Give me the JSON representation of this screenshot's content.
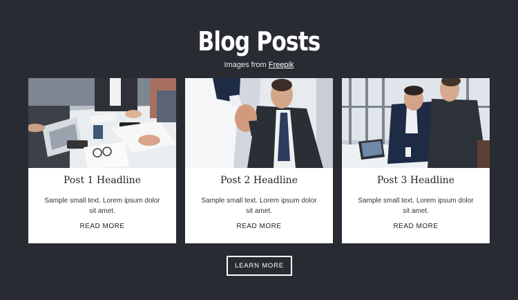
{
  "header": {
    "title": "Blog Posts",
    "credit_prefix": "Images from",
    "credit_link": "Freepik"
  },
  "posts": [
    {
      "headline": "Post 1 Headline",
      "body": "Sample small text. Lorem ipsum dolor sit amet.",
      "cta": "READ MORE",
      "image_icon": "meeting-table-photo"
    },
    {
      "headline": "Post 2 Headline",
      "body": "Sample small text. Lorem ipsum dolor sit amet.",
      "cta": "READ MORE",
      "image_icon": "handshake-photo"
    },
    {
      "headline": "Post 3 Headline",
      "body": "Sample small text. Lorem ipsum dolor sit amet.",
      "cta": "READ MORE",
      "image_icon": "office-discussion-photo"
    }
  ],
  "footer": {
    "button_label": "LEARN MORE"
  },
  "colors": {
    "background": "#292b33",
    "card": "#ffffff",
    "text_dark": "#222222"
  }
}
